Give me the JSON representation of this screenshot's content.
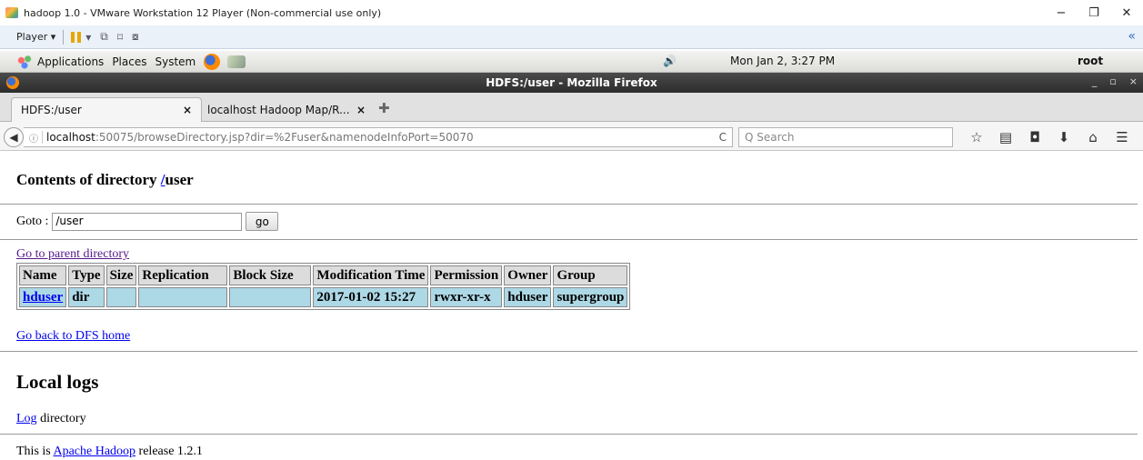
{
  "vmware": {
    "title": "hadoop 1.0 - VMware Workstation 12 Player (Non-commercial use only)",
    "player_menu": "Player ▾",
    "minimize": "−",
    "restore": "❐",
    "close": "✕",
    "toolbar_icons": [
      "▾",
      "⧉",
      "⌑",
      "⧇"
    ],
    "collapse": "«"
  },
  "gnome_panel": {
    "menus": [
      "Applications",
      "Places",
      "System"
    ],
    "speaker": "🔊",
    "clock": "Mon Jan  2,  3:27 PM",
    "user": "root"
  },
  "firefox": {
    "window_title": "HDFS:/user - Mozilla Firefox",
    "window_controls": [
      "_",
      "▫",
      "×"
    ],
    "tabs": [
      {
        "title": "HDFS:/user",
        "close": "×"
      },
      {
        "title": "localhost Hadoop Map/R...",
        "close": "×"
      }
    ],
    "new_tab": "✚",
    "url_host": "localhost",
    "url_rest": ":50075/browseDirectory.jsp?dir=%2Fuser&namenodeInfoPort=50070",
    "reload": "C",
    "search_placeholder": "Q  Search",
    "nav_icons": [
      "☆",
      "▤",
      "◘",
      "⬇",
      "⌂",
      "☰"
    ]
  },
  "page": {
    "heading_prefix": "Contents of directory ",
    "heading_link": "/",
    "heading_suffix": "user",
    "goto_label": "Goto : ",
    "goto_value": "/user",
    "go_button": "go",
    "parent_link": "Go to parent directory",
    "table": {
      "headers": [
        "Name",
        "Type",
        "Size",
        "Replication",
        "Block Size",
        "Modification Time",
        "Permission",
        "Owner",
        "Group"
      ],
      "rows": [
        [
          "hduser",
          "dir",
          "",
          "",
          "",
          "2017-01-02 15:27",
          "rwxr-xr-x",
          "hduser",
          "supergroup"
        ]
      ]
    },
    "dfs_home_link": "Go back to DFS home",
    "local_logs_heading": "Local logs",
    "log_link": "Log",
    "log_suffix": " directory",
    "release_prefix": "This is ",
    "release_link": "Apache Hadoop",
    "release_suffix": " release 1.2.1"
  }
}
